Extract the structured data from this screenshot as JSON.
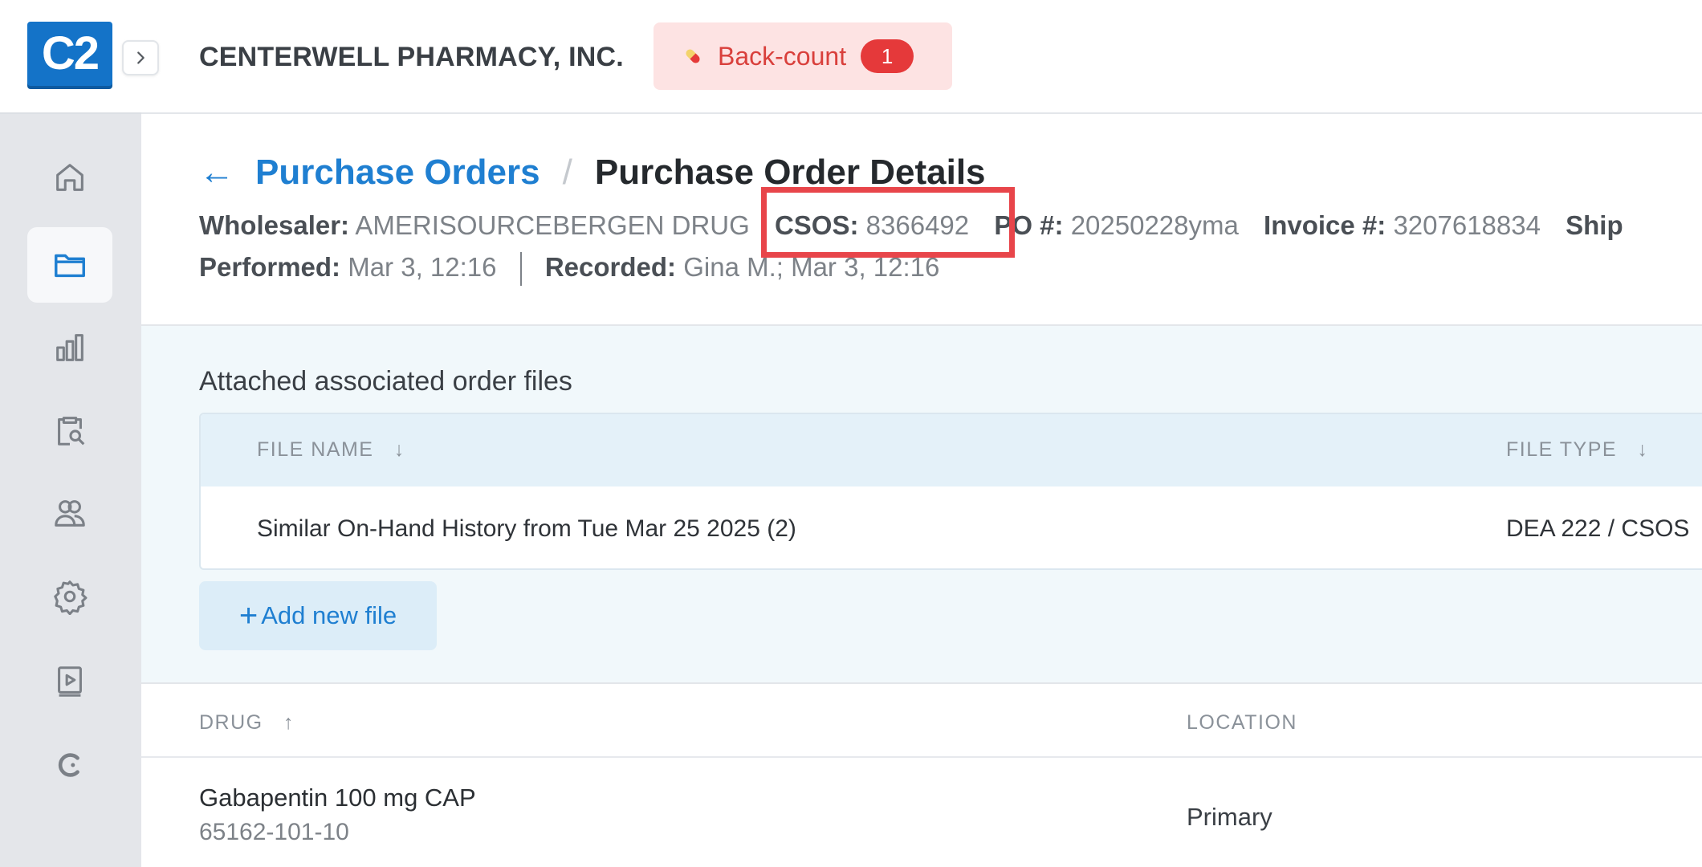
{
  "app": {
    "logo_text": "C2",
    "company": "CENTERWELL PHARMACY, INC.",
    "backcount": {
      "label": "Back-count",
      "badge": "1"
    }
  },
  "breadcrumb": {
    "parent": "Purchase Orders",
    "separator": "/",
    "current": "Purchase Order Details"
  },
  "meta": {
    "wholesaler_label": "Wholesaler:",
    "wholesaler_value": "AMERISOURCEBERGEN DRUG",
    "csos_label": "CSOS:",
    "csos_value": "8366492",
    "po_label": "PO #:",
    "po_value": "20250228yma",
    "invoice_label": "Invoice #:",
    "invoice_value": "3207618834",
    "ship_label": "Ship",
    "performed_label": "Performed:",
    "performed_value": "Mar 3, 12:16",
    "recorded_label": "Recorded:",
    "recorded_value": "Gina M.; Mar 3, 12:16"
  },
  "files": {
    "title": "Attached associated order files",
    "columns": {
      "name": "FILE NAME",
      "type": "FILE TYPE"
    },
    "sort_icon": "↓",
    "rows": [
      {
        "name": "Similar On-Hand History from Tue Mar 25 2025 (2)",
        "type": "DEA 222 / CSOS"
      }
    ],
    "add_label": "Add new file"
  },
  "drugs": {
    "columns": {
      "drug": "DRUG",
      "location": "LOCATION"
    },
    "sort_icon": "↑",
    "rows": [
      {
        "name": "Gabapentin 100 mg CAP",
        "ndc": "65162-101-10",
        "location": "Primary"
      }
    ]
  },
  "colors": {
    "accent": "#1f7fd1",
    "logo": "#1473c8",
    "backcount_bg": "#fde3e3",
    "backcount_text": "#d9403c",
    "highlight": "#e8454a"
  },
  "icons": [
    "home-icon",
    "folder-icon",
    "bar-chart-icon",
    "clipboard-search-icon",
    "users-icon",
    "gear-icon",
    "video-tutorial-icon",
    "brand-c-icon",
    "pill-icon",
    "chevron-right-icon"
  ]
}
